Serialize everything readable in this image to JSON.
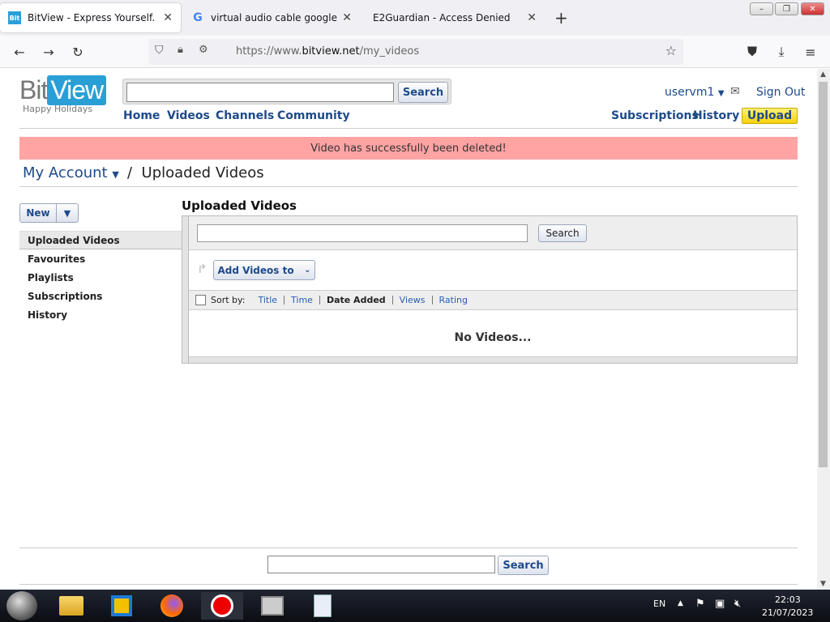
{
  "browser": {
    "tabs": [
      {
        "title": "BitView - Express Yourself.",
        "active": true
      },
      {
        "title": "virtual audio cable google drive",
        "active": false
      },
      {
        "title": "E2Guardian - Access Denied",
        "active": false
      }
    ],
    "new_tab": "+",
    "url_domain": "bitview.net",
    "url_prefix": "https://www.",
    "url_path": "/my_videos"
  },
  "site": {
    "logo_bit": "Bit",
    "logo_view": "View",
    "logo_tagline": "Happy Holidays",
    "search_button": "Search",
    "search_placeholder": "",
    "nav": [
      "Home",
      "Videos",
      "Channels",
      "Community"
    ],
    "user": "uservm1",
    "sign_out": "Sign Out",
    "subscriptions": "Subscriptions",
    "history": "History",
    "upload": "Upload"
  },
  "message": "Video has successfully been deleted!",
  "breadcrumb": {
    "account": "My Account",
    "separator": "/",
    "current": "Uploaded Videos"
  },
  "sidebar": {
    "new_button": "New",
    "items": [
      {
        "label": "Uploaded Videos",
        "selected": true
      },
      {
        "label": "Favourites"
      },
      {
        "label": "Playlists"
      },
      {
        "label": "Subscriptions"
      },
      {
        "label": "History"
      }
    ]
  },
  "main": {
    "heading": "Uploaded Videos",
    "search_button": "Search",
    "add_videos_to": "Add Videos to",
    "sort_by": "Sort by:",
    "sort_options": [
      "Title",
      "Time",
      "Date Added",
      "Views",
      "Rating"
    ],
    "sort_active": "Date Added",
    "empty": "No Videos..."
  },
  "footer": {
    "search_button": "Search"
  },
  "taskbar": {
    "lang": "EN",
    "time": "22:03",
    "date": "21/07/2023"
  }
}
